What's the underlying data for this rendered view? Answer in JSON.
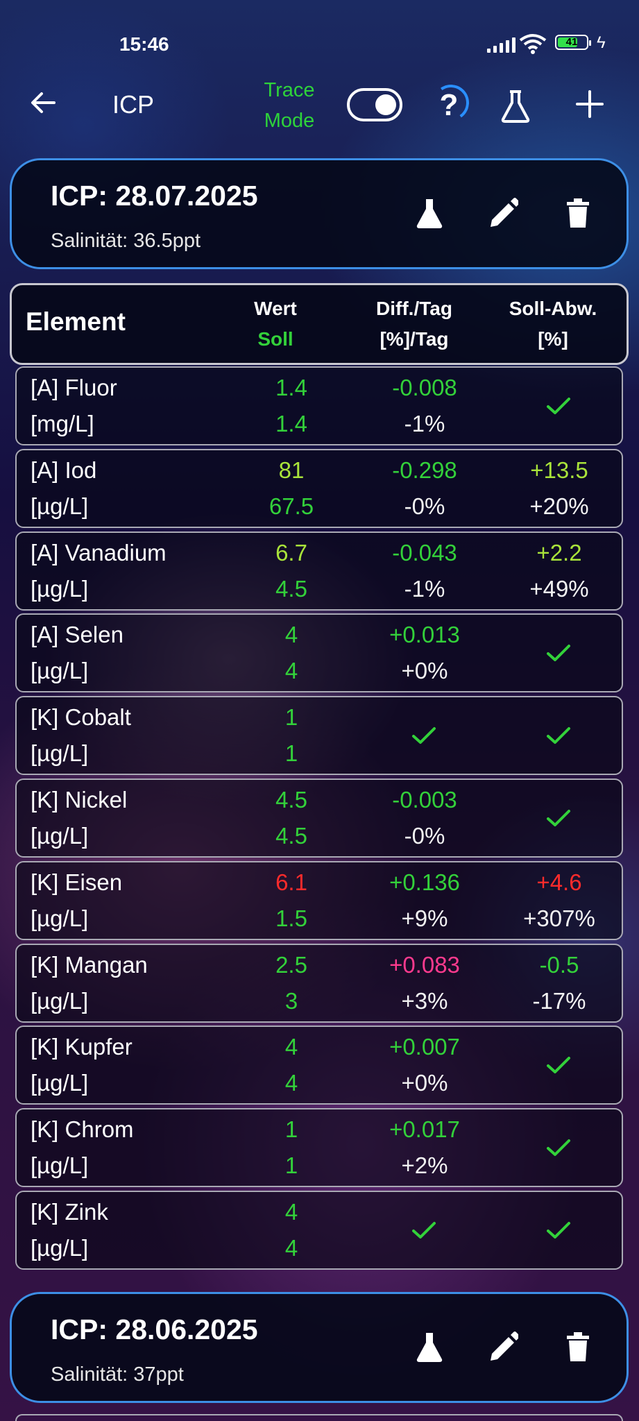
{
  "status": {
    "time": "15:46",
    "battery": "41"
  },
  "appbar": {
    "title": "ICP",
    "trace_mode": [
      "Trace",
      "Mode"
    ],
    "trace_enabled": true
  },
  "cards": [
    {
      "title": "ICP: 28.07.2025",
      "salinity": "Salinität: 36.5ppt"
    },
    {
      "title": "ICP: 28.06.2025",
      "salinity": "Salinität: 37ppt"
    }
  ],
  "header": {
    "element": "Element",
    "wert": "Wert",
    "soll": "Soll",
    "diff": "Diff./Tag",
    "diff_unit": "[%]/Tag",
    "abw": "Soll-Abw.",
    "abw_unit": "[%]"
  },
  "rows": [
    {
      "name": "[A] Fluor",
      "unit": "[mg/L]",
      "wert": "1.4",
      "soll": "1.4",
      "diff": "-0.008",
      "diff_pct": "-1%",
      "abw": "",
      "abw_pct": ""
    },
    {
      "name": "[A] Iod",
      "unit": "[µg/L]",
      "wert": "81",
      "soll": "67.5",
      "diff": "-0.298",
      "diff_pct": "-0%",
      "abw": "+13.5",
      "abw_pct": "+20%"
    },
    {
      "name": "[A] Vanadium",
      "unit": "[µg/L]",
      "wert": "6.7",
      "soll": "4.5",
      "diff": "-0.043",
      "diff_pct": "-1%",
      "abw": "+2.2",
      "abw_pct": "+49%"
    },
    {
      "name": "[A] Selen",
      "unit": "[µg/L]",
      "wert": "4",
      "soll": "4",
      "diff": "+0.013",
      "diff_pct": "+0%",
      "abw": "",
      "abw_pct": ""
    },
    {
      "name": "[K] Cobalt",
      "unit": "[µg/L]",
      "wert": "1",
      "soll": "1",
      "diff": "",
      "diff_pct": "",
      "abw": "",
      "abw_pct": ""
    },
    {
      "name": "[K] Nickel",
      "unit": "[µg/L]",
      "wert": "4.5",
      "soll": "4.5",
      "diff": "-0.003",
      "diff_pct": "-0%",
      "abw": "",
      "abw_pct": ""
    },
    {
      "name": "[K] Eisen",
      "unit": "[µg/L]",
      "wert": "6.1",
      "soll": "1.5",
      "diff": "+0.136",
      "diff_pct": "+9%",
      "abw": "+4.6",
      "abw_pct": "+307%"
    },
    {
      "name": "[K] Mangan",
      "unit": "[µg/L]",
      "wert": "2.5",
      "soll": "3",
      "diff": "+0.083",
      "diff_pct": "+3%",
      "abw": "-0.5",
      "abw_pct": "-17%"
    },
    {
      "name": "[K] Kupfer",
      "unit": "[µg/L]",
      "wert": "4",
      "soll": "4",
      "diff": "+0.007",
      "diff_pct": "+0%",
      "abw": "",
      "abw_pct": ""
    },
    {
      "name": "[K] Chrom",
      "unit": "[µg/L]",
      "wert": "1",
      "soll": "1",
      "diff": "+0.017",
      "diff_pct": "+2%",
      "abw": "",
      "abw_pct": ""
    },
    {
      "name": "[K] Zink",
      "unit": "[µg/L]",
      "wert": "4",
      "soll": "4",
      "diff": "",
      "diff_pct": "",
      "abw": "",
      "abw_pct": ""
    }
  ],
  "colors": {
    "accent_green": "#33d13a",
    "lime": "#a9e33a",
    "alert_red": "#ff2b2b",
    "alert_pink": "#ff3a8e",
    "card_border": "#3d8fe6"
  },
  "icons": [
    "back-arrow-icon",
    "help-icon",
    "flask-icon",
    "plus-icon",
    "pencil-icon",
    "trash-icon",
    "checkmark-icon"
  ]
}
